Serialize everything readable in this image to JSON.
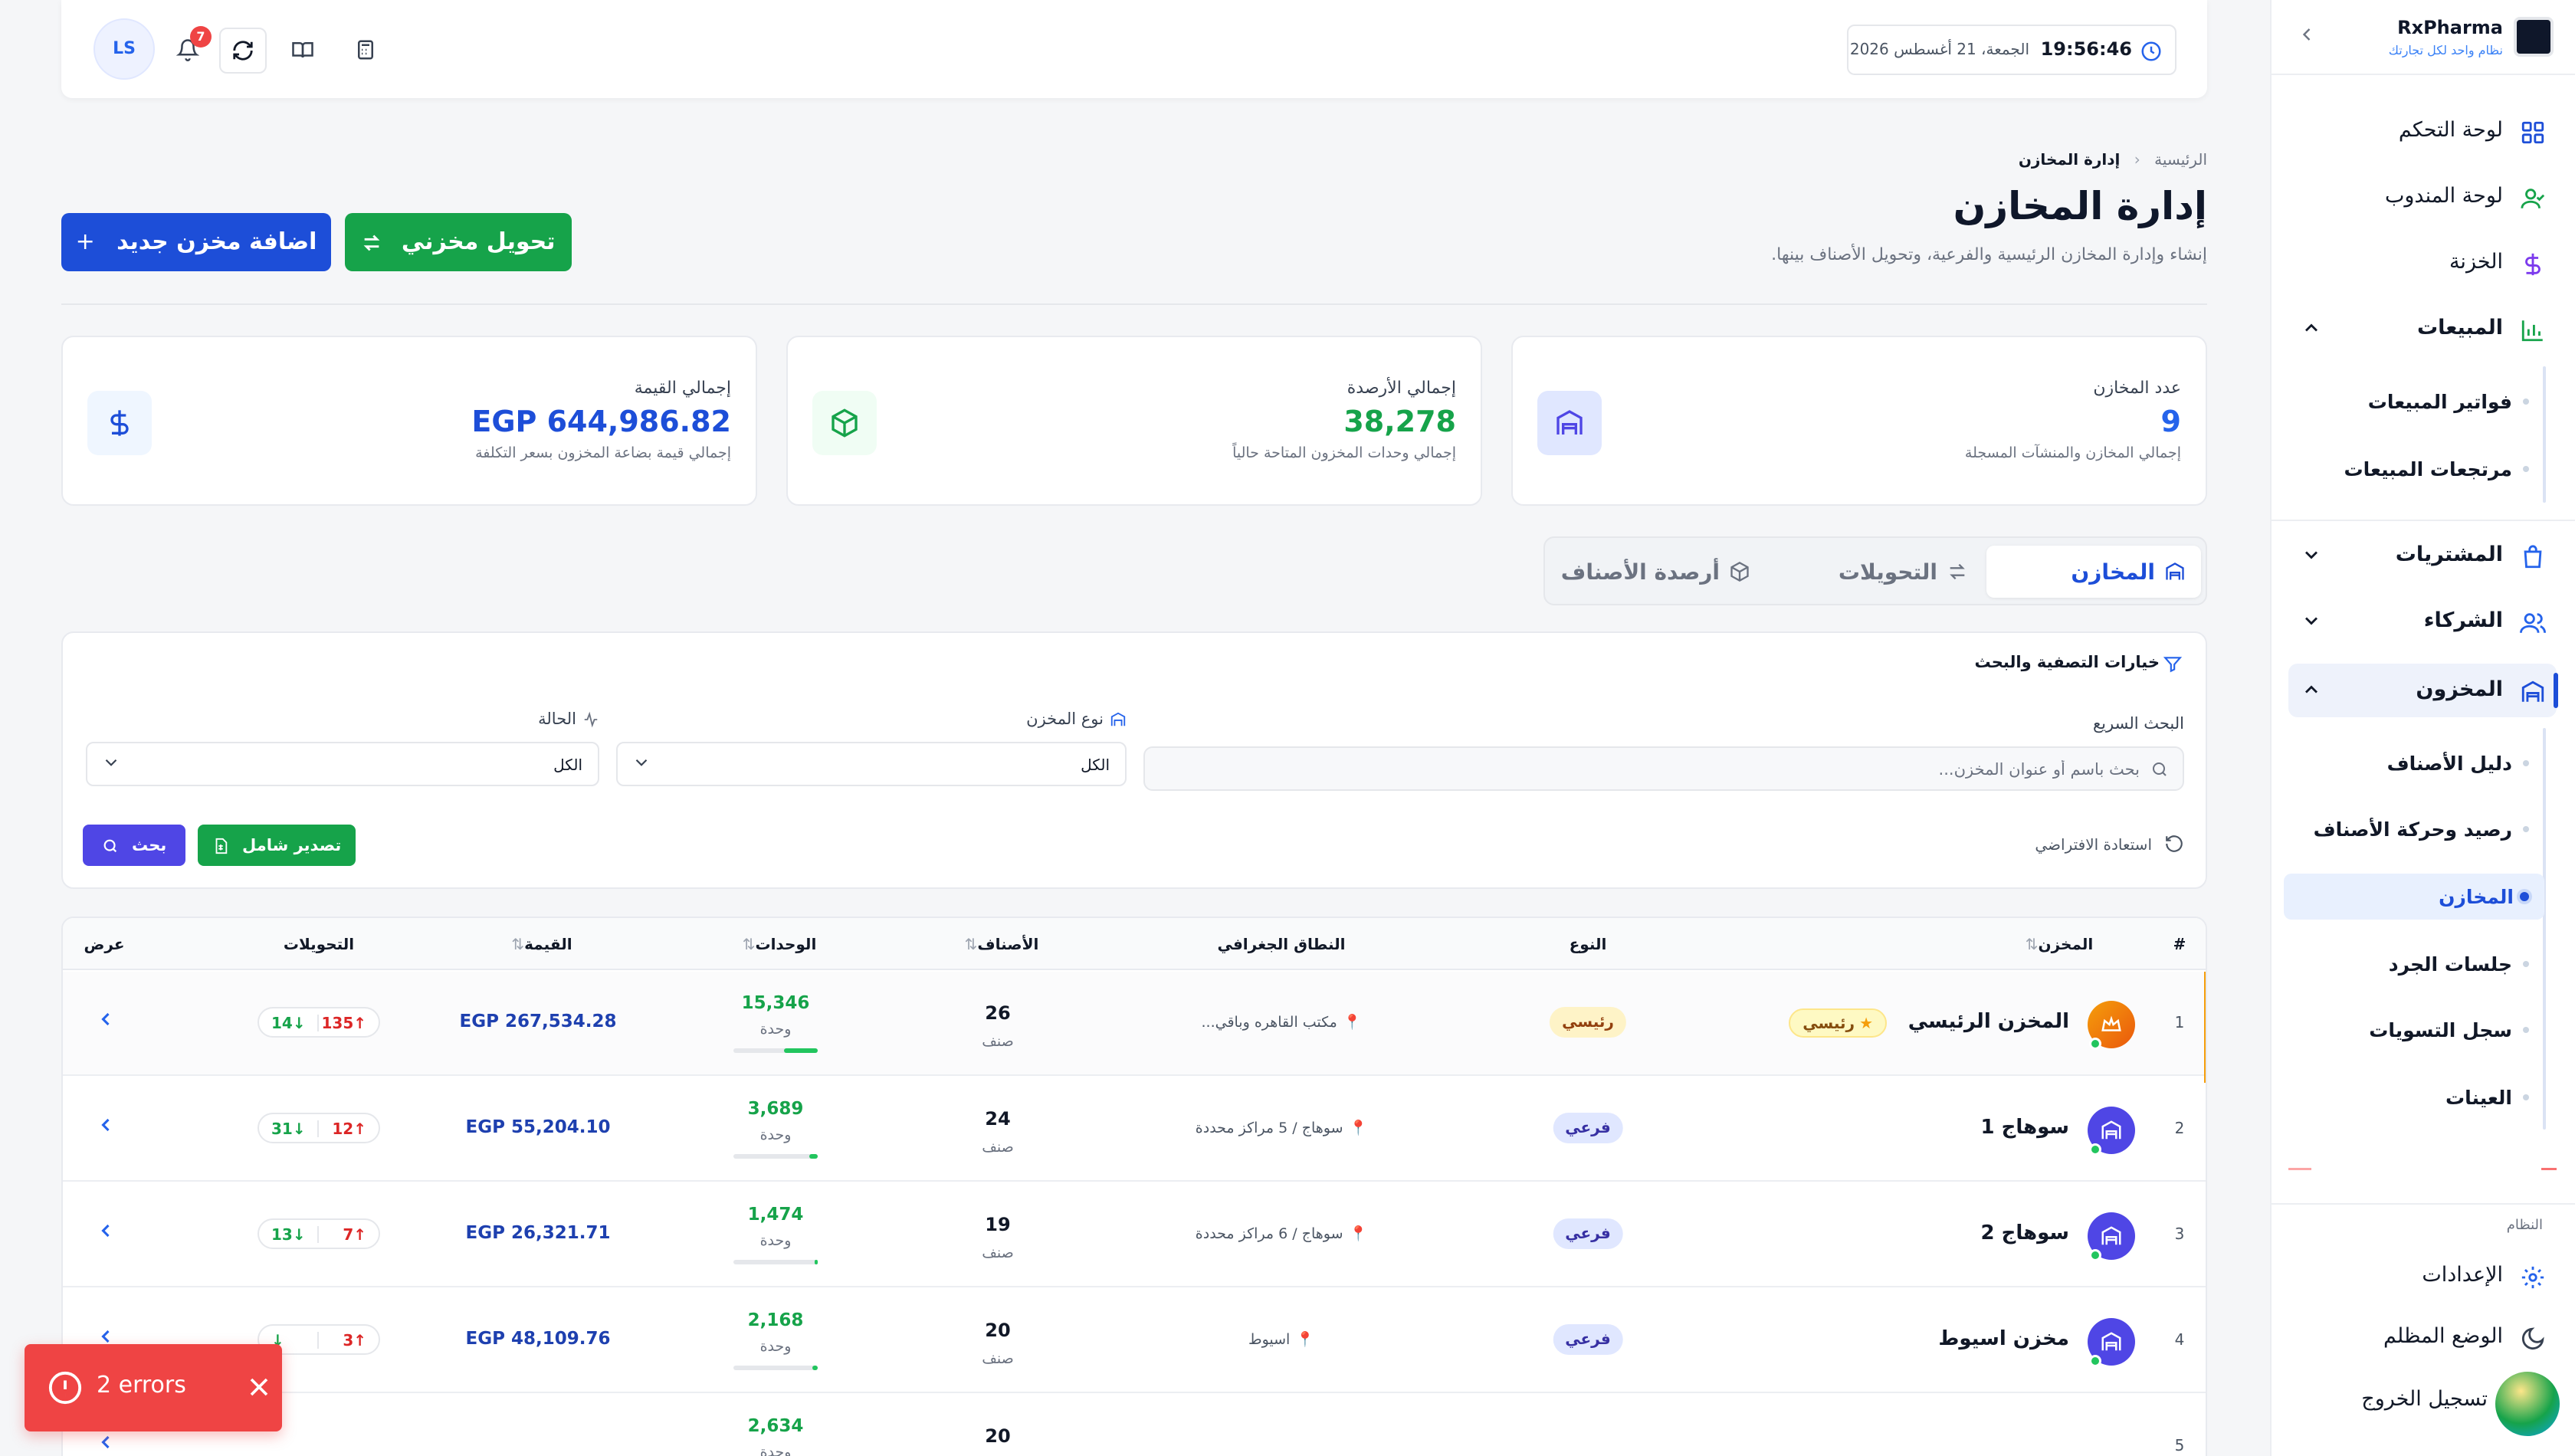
{
  "brand": {
    "name": "RxPharma",
    "tagline": "نظام واحد لكل تجارتك"
  },
  "sidebar": {
    "items": [
      {
        "label": "لوحة التحكم",
        "icon": "dashboard-grid-icon"
      },
      {
        "label": "لوحة المندوب",
        "icon": "user-check-icon"
      },
      {
        "label": "الخزنة",
        "icon": "dollar-icon"
      },
      {
        "label": "المبيعات",
        "icon": "bar-chart-icon",
        "expanded": true
      },
      {
        "label": "المشتريات",
        "icon": "shopping-bag-icon"
      },
      {
        "label": "الشركاء",
        "icon": "users-icon"
      },
      {
        "label": "المخزون",
        "icon": "warehouse-icon",
        "expanded": true,
        "active": true
      }
    ],
    "sales_sub": [
      "فواتير المبيعات",
      "مرتجعات المبيعات"
    ],
    "inventory_sub": [
      "دليل الأصناف",
      "رصيد وحركة الأصناف",
      "المخازن",
      "جلسات الجرد",
      "سجل التسويات",
      "العينات"
    ],
    "system_label": "النظام",
    "system_items": [
      "الإعدادات",
      "الوضع المظلم",
      "تسجيل الخروج"
    ]
  },
  "topbar": {
    "time": "19:56:46",
    "date": "الجمعة، 21 أغسطس 2026",
    "avatar_initials": "LS",
    "notification_count": "7"
  },
  "header": {
    "breadcrumb_home": "الرئيسية",
    "breadcrumb_current": "إدارة المخازن",
    "title": "إدارة المخازن",
    "subtitle": "إنشاء وإدارة المخازن الرئيسية والفرعية، وتحويل الأصناف بينها.",
    "transfer_button": "تحويل مخزني",
    "add_button": "اضافة مخزن جديد"
  },
  "stats": [
    {
      "title": "عدد المخازن",
      "value": "9",
      "desc": "إجمالي المخازن والمنشآت المسجلة",
      "color": "#2563eb"
    },
    {
      "title": "إجمالي الأرصدة",
      "value": "38,278",
      "desc": "إجمالي وحدات المخزون المتاحة حالياً",
      "color": "#16a34a"
    },
    {
      "title": "إجمالي القيمة",
      "value": "EGP 644,986.82",
      "desc": "إجمالي قيمة بضاعة المخزون بسعر التكلفة",
      "color": "#1d4ed8"
    }
  ],
  "tabs": [
    "المخازن",
    "التحويلات",
    "أرصدة الأصناف"
  ],
  "filters": {
    "title": "خيارات التصفية والبحث",
    "search_label": "البحث السريع",
    "search_placeholder": "بحث باسم أو عنوان المخزن...",
    "type_label": "نوع المخزن",
    "type_value": "الكل",
    "status_label": "الحالة",
    "status_value": "الكل",
    "reset_label": "استعادة الافتراضي",
    "export_label": "تصدير شامل",
    "search_button": "بحث"
  },
  "table": {
    "headers": {
      "num": "#",
      "warehouse": "المخزن",
      "type": "النوع",
      "scope": "النطاق الجغرافي",
      "items": "الأصناف",
      "units": "الوحدات",
      "value": "القيمة",
      "transfers": "التحويلات",
      "view": "عرض"
    },
    "unit_word": "وحدة",
    "item_word": "صنف",
    "rows": [
      {
        "num": "1",
        "name": "المخزن الرئيسي",
        "main_badge": "رئيسي",
        "type": "رئيسي",
        "scope": "مكتب القاهره وباقي...",
        "items": "26",
        "units": "15,346",
        "units_share": 0.4,
        "value": "EGP 267,534.28",
        "t_in": "135",
        "t_out": "14"
      },
      {
        "num": "2",
        "name": "سوهاج 1",
        "type": "فرعي",
        "scope": "سوهاج / 5 مراكز محددة",
        "items": "24",
        "units": "3,689",
        "units_share": 0.1,
        "value": "EGP 55,204.10",
        "t_in": "12",
        "t_out": "31"
      },
      {
        "num": "3",
        "name": "سوهاج 2",
        "type": "فرعي",
        "scope": "سوهاج / 6 مراكز محددة",
        "items": "19",
        "units": "1,474",
        "units_share": 0.04,
        "value": "EGP 26,321.71",
        "t_in": "7",
        "t_out": "13"
      },
      {
        "num": "4",
        "name": "مخزن اسيوط",
        "type": "فرعي",
        "scope": "اسيوط",
        "items": "20",
        "units": "2,168",
        "units_share": 0.06,
        "value": "EGP 48,109.76",
        "t_in": "3",
        "t_out": ""
      },
      {
        "num": "5",
        "name": "",
        "type": "",
        "scope": "",
        "items": "20",
        "units": "2,634",
        "units_share": 0.07,
        "value": "",
        "t_in": "",
        "t_out": ""
      }
    ]
  },
  "toast": {
    "text": "2 errors"
  },
  "colors": {
    "primary": "#1d4ed8",
    "success": "#16a34a",
    "accent_button_blue": "#1d4ed8",
    "accent_button_green": "#16a34a",
    "danger": "#ef4444",
    "main_row_accent": "#f59e0b"
  }
}
